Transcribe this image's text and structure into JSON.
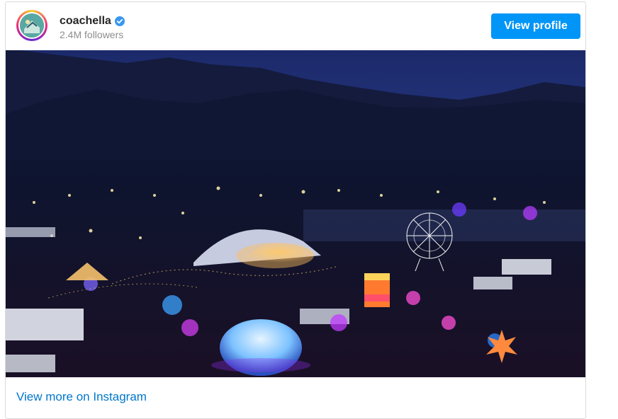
{
  "post": {
    "username": "coachella",
    "verified": true,
    "followers_text": "2.4M followers",
    "view_profile_label": "View profile",
    "view_more_label": "View more on Instagram"
  },
  "colors": {
    "button_bg": "#0095f6",
    "link": "#0077cc",
    "verified_badge": "#3897f0"
  },
  "icons": {
    "avatar": "coachella-logo",
    "verified": "verified-badge-icon"
  },
  "photo": {
    "subject": "aerial night view of a festival with ferris wheel, dome and lit stages"
  }
}
